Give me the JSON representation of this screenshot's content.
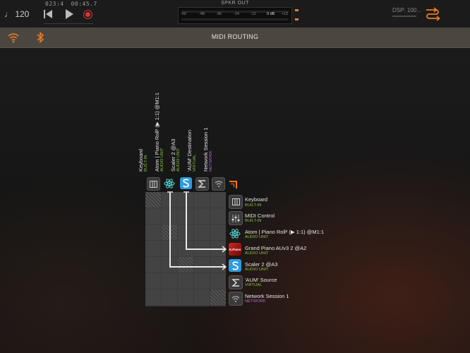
{
  "transport": {
    "tempo": "♩ 120",
    "bars": "023:4",
    "time": "00:45.7"
  },
  "meter": {
    "title": "SPKR OUT",
    "scale": [
      "-60",
      "-48",
      "-36",
      "-24",
      "-12",
      "0 dB",
      "+12"
    ]
  },
  "dsp": {
    "label": "DSP: 100..."
  },
  "header": {
    "title": "MIDI ROUTING"
  },
  "colors": {
    "accent": "#ee7a24",
    "audio_unit": "#8fbf3f",
    "network": "#b561d8",
    "record": "#d8363a"
  },
  "destinations": [
    {
      "name": "Keyboard",
      "type": "BUILT-IN",
      "icon": "piano-keys-icon"
    },
    {
      "name": "Atom | Piano Roll² (▶ 1:1) @M1:1",
      "type": "AUDIO UNIT",
      "icon": "atom-icon"
    },
    {
      "name": "Scaler 2 @A3",
      "type": "AUDIO UNIT",
      "icon": "scaler-icon"
    },
    {
      "name": "'AUM' Destination",
      "type": "VIRTUAL",
      "icon": "sigma-icon"
    },
    {
      "name": "Network Session 1",
      "type": "NETWORK",
      "icon": "network-icon"
    }
  ],
  "sources": [
    {
      "name": "Keyboard",
      "type": "BUILT-IN",
      "icon": "piano-keys-icon"
    },
    {
      "name": "MIDI Control",
      "type": "BUILT-IN",
      "icon": "faders-icon"
    },
    {
      "name": "Atom | Piano Roll² (▶ 1:1) @M1:1",
      "type": "AUDIO UNIT",
      "icon": "atom-icon"
    },
    {
      "name": "Grand Piano AUv3 2 @A2",
      "type": "AUDIO UNIT",
      "icon": "grand-piano-icon",
      "icon_text": "G.Piano"
    },
    {
      "name": "Scaler 2 @A3",
      "type": "AUDIO UNIT",
      "icon": "scaler-icon"
    },
    {
      "name": "'AUM' Source",
      "type": "VIRTUAL",
      "icon": "sigma-icon"
    },
    {
      "name": "Network Session 1",
      "type": "NETWORK",
      "icon": "network-icon"
    }
  ],
  "connections": [
    {
      "from_source": "Atom | Piano Roll² (▶ 1:1) @M1:1",
      "to_destination": "Scaler 2 @A3"
    },
    {
      "from_source": "Scaler 2 @A3",
      "to_destination": "Atom | Piano Roll² (▶ 1:1) @M1:1"
    }
  ]
}
